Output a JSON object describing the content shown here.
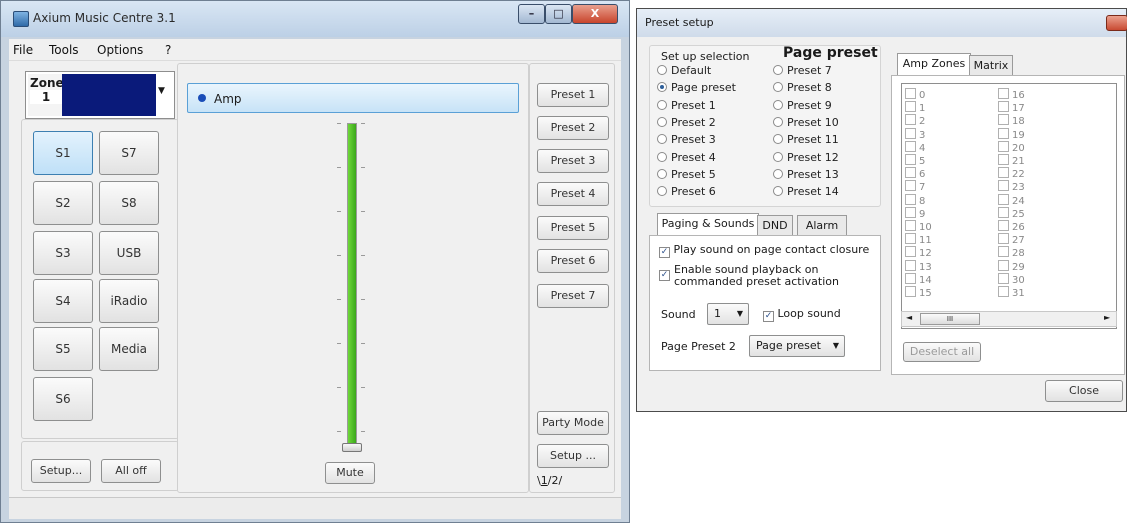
{
  "main": {
    "title": "Axium Music Centre 3.1",
    "caption": {
      "min": "–",
      "max": "□",
      "close": "X"
    },
    "menu": [
      "File",
      "Tools",
      "Options",
      "?"
    ],
    "zone": {
      "label": "Zone",
      "number": "1",
      "color": "#0a1a7a"
    },
    "sources": [
      "S1",
      "S7",
      "S2",
      "S8",
      "S3",
      "USB",
      "S4",
      "iRadio",
      "S5",
      "Media",
      "S6"
    ],
    "bottom_left": {
      "setup": "Setup...",
      "all_off": "All off"
    },
    "amp_label": "Amp",
    "mute": "Mute",
    "volume_level": 1.0,
    "presets": [
      "Preset 1",
      "Preset 2",
      "Preset 3",
      "Preset 4",
      "Preset 5",
      "Preset 6",
      "Preset 7"
    ],
    "party_mode": "Party Mode",
    "setup": "Setup ...",
    "page_tabs": [
      "1",
      "2"
    ]
  },
  "dialog": {
    "title": "Preset setup",
    "setup_selection_label": "Set up selection",
    "page_preset_heading": "Page preset",
    "radios_left": [
      {
        "label": "Default",
        "selected": false
      },
      {
        "label": "Page preset",
        "selected": true
      },
      {
        "label": "Preset 1",
        "selected": false
      },
      {
        "label": "Preset 2",
        "selected": false
      },
      {
        "label": "Preset 3",
        "selected": false
      },
      {
        "label": "Preset 4",
        "selected": false
      },
      {
        "label": "Preset 5",
        "selected": false
      },
      {
        "label": "Preset 6",
        "selected": false
      }
    ],
    "radios_right": [
      "Preset 7",
      "Preset 8",
      "Preset 9",
      "Preset 10",
      "Preset 11",
      "Preset 12",
      "Preset 13",
      "Preset 14"
    ],
    "tabs": [
      "Paging & Sounds",
      "DND",
      "Alarm"
    ],
    "play_sound": "Play sound on page contact closure",
    "enable_playback": "Enable sound playback on commanded preset activation",
    "sound_label": "Sound",
    "sound_value": "1",
    "loop_sound": "Loop sound",
    "page_preset2_label": "Page Preset 2",
    "page_preset2_value": "Page preset",
    "zone_tabs": [
      "Amp Zones",
      "Matrix"
    ],
    "zones_col1": [
      "0",
      "1",
      "2",
      "3",
      "4",
      "5",
      "6",
      "7",
      "8",
      "9",
      "10",
      "11",
      "12",
      "13",
      "14",
      "15"
    ],
    "zones_col2": [
      "16",
      "17",
      "18",
      "19",
      "20",
      "21",
      "22",
      "23",
      "24",
      "25",
      "26",
      "27",
      "28",
      "29",
      "30",
      "31"
    ],
    "scroll_mark": "III",
    "deselect_all": "Deselect all",
    "close": "Close"
  }
}
